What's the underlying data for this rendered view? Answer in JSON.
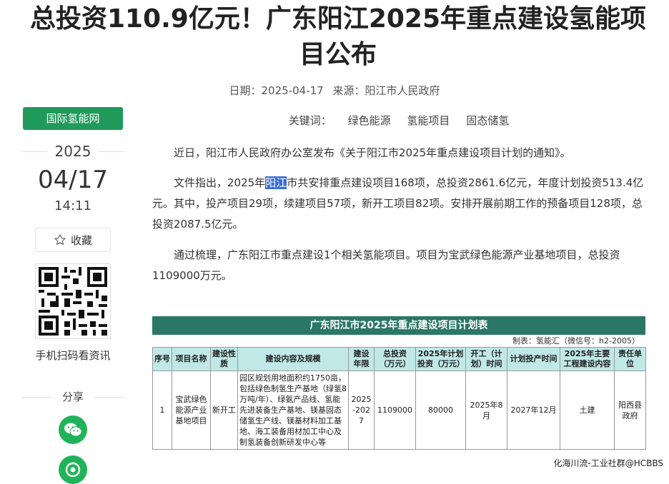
{
  "article": {
    "title_line1": "总投资110.9亿元！广东阳江2025年重点建设氢能项",
    "title_line2": "目公布",
    "date_label": "日期：",
    "date": "2025-04-17",
    "source_label": "来源：",
    "source": "阳江市人民政府",
    "keywords_label": "关键词：",
    "keywords": [
      "绿色能源",
      "氢能项目",
      "固态储氢"
    ],
    "p1": "近日，阳江市人民政府办公室发布《关于阳江市2025年重点建设项目计划的通知》。",
    "p2_before": "文件指出，2025年",
    "p2_highlight": "阳江",
    "p2_after": "市共安排重点建设项目168项，总投资2861.6亿元，年度计划投资513.4亿元。其中，投产项目29项，续建项目57项，新开工项目82项。安排开展前期工作的预备项目128项，总投资2087.5亿元。",
    "p3": "通过梳理，广东阳江市重点建设1个相关氢能项目。项目为宝武绿色能源产业基地项目，总投资1109000万元。"
  },
  "sidebar": {
    "site_name": "国际氢能网",
    "year": "2025",
    "month_day": "04/17",
    "time": "14:11",
    "favorite_label": "收藏",
    "qr_caption": "手机扫码看资讯",
    "share_label": "分享",
    "icons": [
      "star-icon",
      "qr-code-icon",
      "wechat-icon",
      "moments-icon"
    ]
  },
  "table": {
    "title": "广东阳江市2025年重点建设项目计划表",
    "credit": "制表：氢能汇（微信号：h2-2005）",
    "headers": [
      "序号",
      "项目名称",
      "建设性质",
      "建设内容及规模",
      "建设年限",
      "总投资（万元）",
      "2025年计划投资（万元）",
      "开工（计划）时间",
      "计划投产时间",
      "2025年主要工程建设内容",
      "责任单位"
    ],
    "rows": [
      [
        "1",
        "宝武绿色能源产业基地项目",
        "新开工",
        "园区规划用地面积约1750亩，包括绿色制氢生产基地（绿氢8万吨/年）、绿氨产品线、氢能先进装备生产基地、镁基固态储氢生产线、镁基材料加工基地、海工装备用材加工中心及制氢装备创新研发中心等",
        "2025-2027",
        "1109000",
        "80000",
        "2025年8月",
        "2027年12月",
        "土建",
        "阳西县政府"
      ]
    ]
  },
  "watermark": "化海川流-工业社群@HCBBS",
  "colors": {
    "brand_green": "#1f9a5a",
    "table_header": "#2b7766",
    "table_col_header": "#bfe8e7",
    "highlight": "#3a6fd8"
  }
}
